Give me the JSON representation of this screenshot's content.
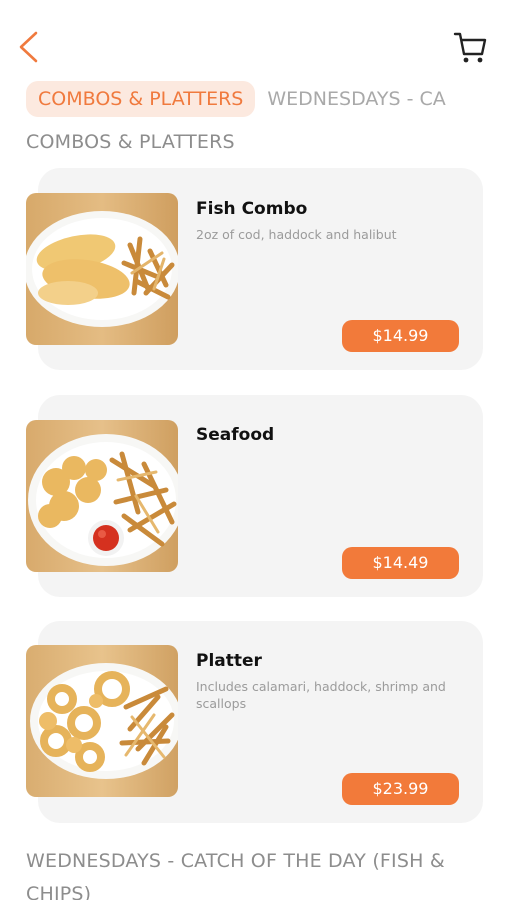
{
  "colors": {
    "accent": "#f27a3a",
    "tab_bg": "#fce9df",
    "card_bg": "#f4f4f4",
    "muted_text": "#9b9b9b"
  },
  "header": {
    "back_icon": "chevron-left-icon",
    "cart_icon": "cart-icon"
  },
  "tabs": [
    {
      "label": "COMBOS & PLATTERS",
      "active": true
    },
    {
      "label": "WEDNESDAYS - CA",
      "active": false
    }
  ],
  "sections": [
    {
      "title": "COMBOS & PLATTERS",
      "items": [
        {
          "name": "Fish Combo",
          "description": "2oz of cod, haddock and halibut",
          "price": "$14.99"
        },
        {
          "name": "Seafood",
          "description": "",
          "price": "$14.49"
        },
        {
          "name": "Platter",
          "description": "Includes calamari, haddock, shrimp and scallops",
          "price": "$23.99"
        }
      ]
    },
    {
      "title": "WEDNESDAYS - CATCH OF THE DAY (FISH & CHIPS)"
    }
  ]
}
